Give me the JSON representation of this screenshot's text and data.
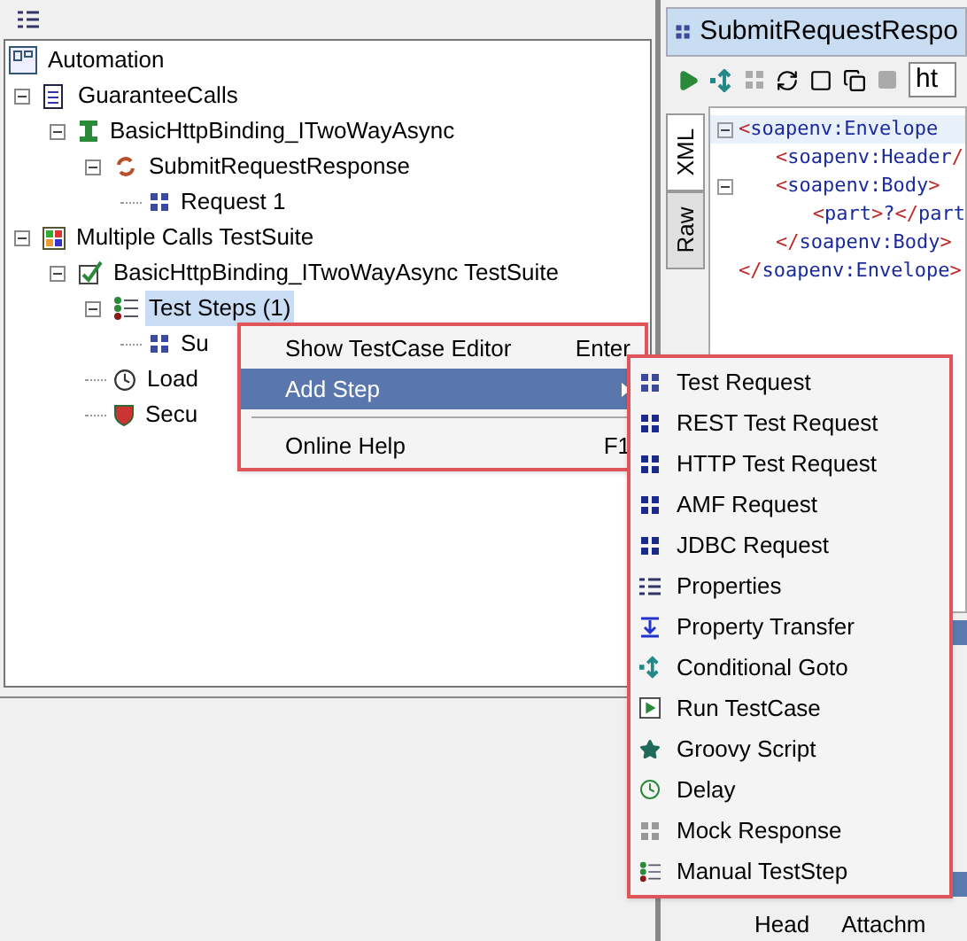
{
  "tree": [
    {
      "label": "Automation",
      "kind": "project",
      "children": [
        {
          "label": "GuaranteeCalls",
          "kind": "interface",
          "expanded": true,
          "children": [
            {
              "label": "BasicHttpBinding_ITwoWayAsync",
              "kind": "binding",
              "expanded": true,
              "children": [
                {
                  "label": "SubmitRequestResponse",
                  "kind": "operation",
                  "expanded": true,
                  "children": [
                    {
                      "label": "Request 1",
                      "kind": "soap",
                      "selected": false
                    }
                  ]
                }
              ]
            }
          ]
        },
        {
          "label": "Multiple Calls TestSuite",
          "kind": "suite",
          "expanded": true,
          "children": [
            {
              "label": "BasicHttpBinding_ITwoWayAsync TestSuite",
              "kind": "testcase",
              "expanded": true,
              "children": [
                {
                  "label": "Test Steps (1)",
                  "kind": "steps",
                  "expanded": true,
                  "selected": true,
                  "children": [
                    {
                      "label": "Su",
                      "kind": "soap",
                      "selected": false
                    }
                  ]
                },
                {
                  "label": "Load",
                  "kind": "load",
                  "selected": false
                },
                {
                  "label": "Secu",
                  "kind": "security",
                  "selected": false
                }
              ]
            }
          ]
        }
      ]
    }
  ],
  "context_menu": [
    {
      "kind": "item",
      "label": "Show TestCase Editor",
      "shortcut": "Enter",
      "selected": false
    },
    {
      "kind": "submenu",
      "label": "Add Step",
      "selected": true
    },
    {
      "kind": "separator"
    },
    {
      "kind": "item",
      "label": "Online Help",
      "shortcut": "F1",
      "selected": false
    }
  ],
  "add_step_menu": [
    {
      "label": "Test Request",
      "kind": "soap"
    },
    {
      "label": "REST Test Request",
      "kind": "rest"
    },
    {
      "label": "HTTP Test Request",
      "kind": "http"
    },
    {
      "label": "AMF Request",
      "kind": "amf"
    },
    {
      "label": "JDBC Request",
      "kind": "jdbc"
    },
    {
      "label": "Properties",
      "kind": "properties"
    },
    {
      "label": "Property Transfer",
      "kind": "transfer"
    },
    {
      "label": "Conditional Goto",
      "kind": "goto"
    },
    {
      "label": "Run TestCase",
      "kind": "run"
    },
    {
      "label": "Groovy Script",
      "kind": "groovy"
    },
    {
      "label": "Delay",
      "kind": "delay"
    },
    {
      "label": "Mock Response",
      "kind": "mock"
    },
    {
      "label": "Manual TestStep",
      "kind": "manual"
    }
  ],
  "editor": {
    "title": "SubmitRequestRespo",
    "endpoint": "ht",
    "tabs": [
      {
        "label": "XML",
        "selected": true
      },
      {
        "label": "Raw",
        "selected": false
      }
    ],
    "xml": [
      {
        "open": "<soapenv:Envelope",
        "close": "</soapenv:Envelope>",
        "children": [
          {
            "open": "<soapenv:Header/"
          },
          {
            "open": "<soapenv:Body>",
            "close": "</soapenv:Body>",
            "children": [
              {
                "open": "<part>?</part"
              }
            ]
          }
        ]
      }
    ]
  },
  "lower_panel": {
    "tabs": [
      "Head",
      "Attachm"
    ]
  }
}
